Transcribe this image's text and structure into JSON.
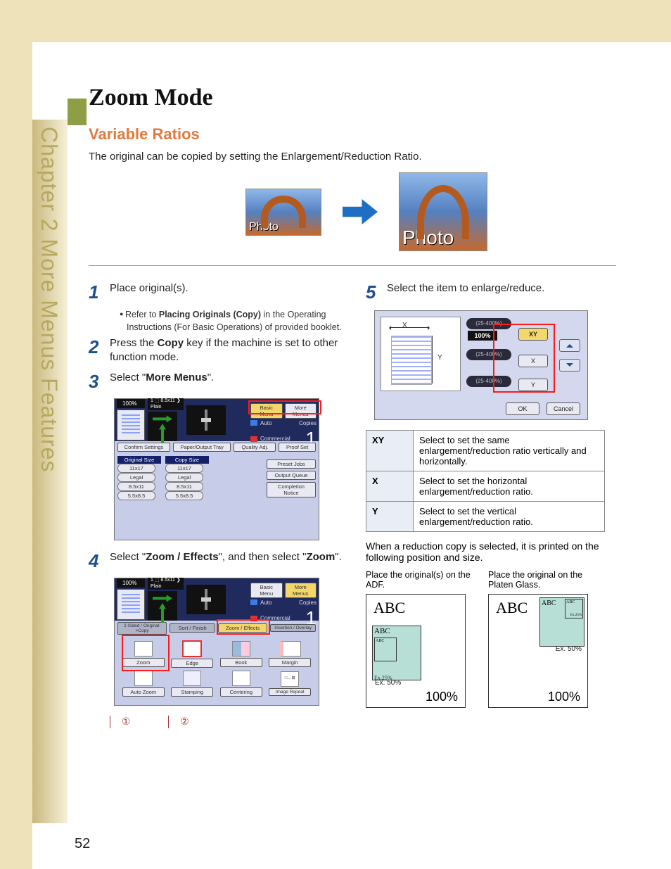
{
  "page": {
    "number": "52",
    "side_label": "Chapter 2    More Menus Features"
  },
  "heading": {
    "title": "Zoom Mode",
    "section": "Variable Ratios",
    "intro": "The original can be copied by setting the Enlargement/Reduction Ratio."
  },
  "photo_labels": {
    "small": "Photo",
    "large": "Photo"
  },
  "steps": {
    "s1": {
      "n": "1",
      "text": "Place original(s)."
    },
    "s1_note_pre": "Refer to ",
    "s1_note_bold": "Placing Originals (Copy)",
    "s1_note_post": " in the Operating Instructions (For Basic Operations) of provided booklet.",
    "s2": {
      "n": "2",
      "text_pre": "Press the ",
      "text_bold": "Copy",
      "text_post": " key if the machine is set to other function mode."
    },
    "s3": {
      "n": "3",
      "text_pre": "Select \"",
      "text_bold": "More Menus",
      "text_post": "\"."
    },
    "s4": {
      "n": "4",
      "text_pre": "Select \"",
      "b1": "Zoom / Effects",
      "mid": "\", and then select \"",
      "b2": "Zoom",
      "post": "\"."
    },
    "s5": {
      "n": "5",
      "text": "Select the item to enlarge/reduce."
    }
  },
  "screen3": {
    "zoom": "100%",
    "paper_line1": "1 ⬚ 8.5x11 ❯",
    "paper_line2": "Plain",
    "basic_menu": "Basic Menu",
    "more_menus": "More Menus",
    "auto": "Auto",
    "commercial": "Commercial",
    "copies_label": "Copies",
    "copies_value": "1",
    "confirm": "Confirm Settings",
    "paper_output": "Paper/Output Tray",
    "quality": "Quality Adj.",
    "proof": "Proof Set",
    "orig_hdr": "Original Size",
    "copy_hdr": "Copy Size",
    "sizes": [
      "11x17",
      "11x17",
      "Legal",
      "Legal",
      "8.5x11",
      "8.5x11",
      "5.5x8.5",
      "5.5x8.5"
    ],
    "preset": "Preset Jobs",
    "queue": "Output Queue",
    "completion": "Completion Notice"
  },
  "screen4": {
    "zoom": "100%",
    "paper_line1": "1 ⬚ 8.5x11 ❯",
    "paper_line2": "Plain",
    "basic_menu": "Basic Menu",
    "more_menus": "More Menus",
    "auto": "Auto",
    "commercial": "Commercial",
    "copies_value": "1",
    "tabs": [
      "2-Sided / Original->Copy",
      "Sort / Finish",
      "Zoom / Effects",
      "Insertion / Overlay"
    ],
    "grid": [
      "Zoom",
      "Edge",
      "Book",
      "Margin",
      "Auto Zoom",
      "Stamping",
      "Centering",
      "Image Repeat"
    ],
    "callout1": "①",
    "callout2": "②"
  },
  "screen5": {
    "range": "(25-400%)",
    "value": "100%",
    "btn_xy": "XY",
    "btn_x": "X",
    "btn_y": "Y",
    "xchar": "X",
    "ychar": "Y",
    "ok": "OK",
    "cancel": "Cancel"
  },
  "xytable": {
    "r1k": "XY",
    "r1v": "Select to set the same enlargement/reduction ratio vertically and horizontally.",
    "r2k": "X",
    "r2v": "Select to set the horizontal enlargement/reduction ratio.",
    "r3k": "Y",
    "r3v": "Select to set the vertical enlargement/reduction ratio."
  },
  "reduction": {
    "note": "When a reduction copy is selected, it is printed on the following position and size.",
    "adf_title": "Place the original(s) on the ADF.",
    "glass_title": "Place the original on the Platen Glass.",
    "abc": "ABC",
    "ex50": "Ex. 50%",
    "ex25": "Ex.25%",
    "hundred": "100%"
  }
}
